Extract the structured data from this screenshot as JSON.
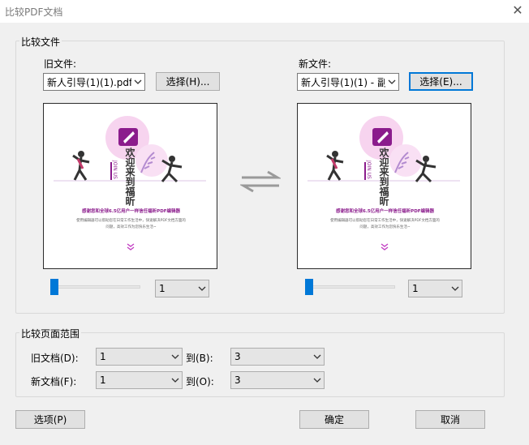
{
  "window": {
    "title": "比较PDF文档"
  },
  "compare_files": {
    "legend": "比较文件",
    "old": {
      "label": "旧文件:",
      "selected_file": "新人引导(1)(1).pdf",
      "choose_button": "选择(H)...",
      "page_value": "1",
      "slider_position": 0
    },
    "new": {
      "label": "新文件:",
      "selected_file": "新人引导(1)(1) - 副",
      "choose_button": "选择(E)...",
      "page_value": "1",
      "slider_position": 0
    },
    "preview": {
      "welcome_text": "欢迎来到福昕",
      "brand_vertical": "JOIN US",
      "headline": "感谢您和全球6.5亿用户一样信任福昕PDF编辑器",
      "body_line1": "使用编辑器可以帮助您在日常工作生活中，快速解决PDF文档方面的",
      "body_line2": "问题，高效工作为您快乐生活~"
    }
  },
  "page_range": {
    "legend": "比较页面范围",
    "old_doc": {
      "label": "旧文档(D):",
      "from": "1",
      "to_label": "到(B):",
      "to": "3"
    },
    "new_doc": {
      "label": "新文档(F):",
      "from": "1",
      "to_label": "到(O):",
      "to": "3"
    }
  },
  "buttons": {
    "options": "选项(P)",
    "ok": "确定",
    "cancel": "取消"
  },
  "colors": {
    "accent": "#0078d7",
    "brand_purple": "#8b1c8c",
    "pink": "#f7d4ef"
  }
}
